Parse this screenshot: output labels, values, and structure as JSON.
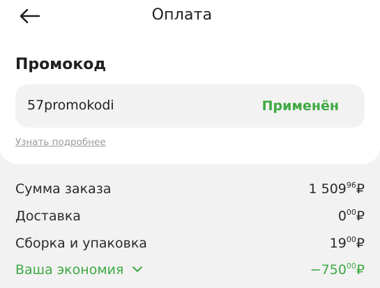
{
  "header": {
    "title": "Оплата",
    "back_icon": "arrow-left-icon"
  },
  "promo": {
    "section_title": "Промокод",
    "code_value": "57promokodi",
    "status": "Применён",
    "learn_more": "Узнать подробнее"
  },
  "summary": {
    "order_total": {
      "label": "Сумма заказа",
      "value_main": "1 509",
      "value_cents": "96",
      "currency": "₽"
    },
    "delivery": {
      "label": "Доставка",
      "value_main": "0",
      "value_cents": "00",
      "currency": "₽"
    },
    "assembly": {
      "label": "Сборка и упаковка",
      "value_main": "19",
      "value_cents": "00",
      "currency": "₽"
    },
    "savings": {
      "label": "Ваша экономия",
      "value_main": "−750",
      "value_cents": "00",
      "currency": "₽",
      "icon": "chevron-down-icon"
    }
  },
  "colors": {
    "accent_green": "#3ea943",
    "background": "#f2f2f2",
    "card": "#ffffff",
    "muted_text": "#9a9a9a"
  }
}
